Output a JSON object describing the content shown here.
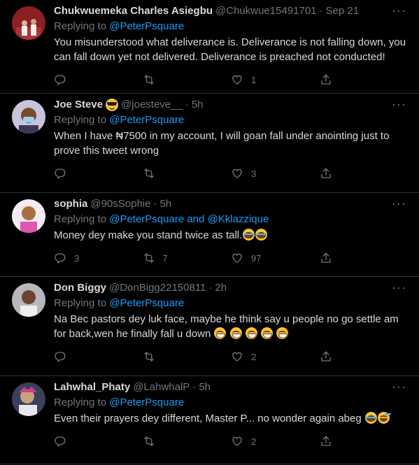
{
  "icons": {
    "reply": "reply-icon",
    "retweet": "retweet-icon",
    "like": "like-icon",
    "share": "share-icon",
    "more": "more-icon"
  },
  "colors": {
    "background": "#000000",
    "text": "#d9d9d9",
    "muted": "#6e767d",
    "link": "#1d9bf0",
    "divider": "#2f3336"
  },
  "more_glyph": "···",
  "dot": "·",
  "replying_prefix": "Replying to",
  "tweets": [
    {
      "name": "Chukwuemeka Charles Asiegbu",
      "handle": "@Chukwue15491701",
      "time": "Sep 21",
      "mentions": [
        "@PeterPsquare"
      ],
      "connector": "",
      "text_parts": [
        "You misunderstood what deliverance is. Deliverance is not falling down, you can fall down yet not delivered. Deliverance is preached not conducted!"
      ],
      "replies": "",
      "retweets": "",
      "likes": "1"
    },
    {
      "name": "Joe Steve",
      "handle": "@joesteve__",
      "time": "5h",
      "mentions": [
        "@PeterPsquare"
      ],
      "connector": "",
      "text_parts": [
        "When I have ₦7500 in my account, I will goan fall under anointing just to prove this tweet wrong"
      ],
      "replies": "",
      "retweets": "",
      "likes": "3"
    },
    {
      "name": "sophia",
      "handle": "@90sSophie",
      "time": "5h",
      "mentions": [
        "@PeterPsquare",
        "@Kklazzique"
      ],
      "connector": "and",
      "text_parts": [
        "Money dey make you stand twice as tall."
      ],
      "replies": "3",
      "retweets": "7",
      "likes": "97"
    },
    {
      "name": "Don Biggy",
      "handle": "@DonBigg22150811",
      "time": "2h",
      "mentions": [
        "@PeterPsquare"
      ],
      "connector": "",
      "text_parts": [
        "Na Bec pastors dey luk face, maybe he think say u people no go settle am for back,wen he finally fall u down "
      ],
      "replies": "",
      "retweets": "",
      "likes": "2"
    },
    {
      "name": "Lahwhal_Phaty",
      "handle": "@LahwhalP",
      "time": "5h",
      "mentions": [
        "@PeterPsquare"
      ],
      "connector": "",
      "text_parts": [
        "Even their prayers dey different, Master P... no wonder again abeg "
      ],
      "replies": "",
      "retweets": "",
      "likes": "2"
    }
  ]
}
